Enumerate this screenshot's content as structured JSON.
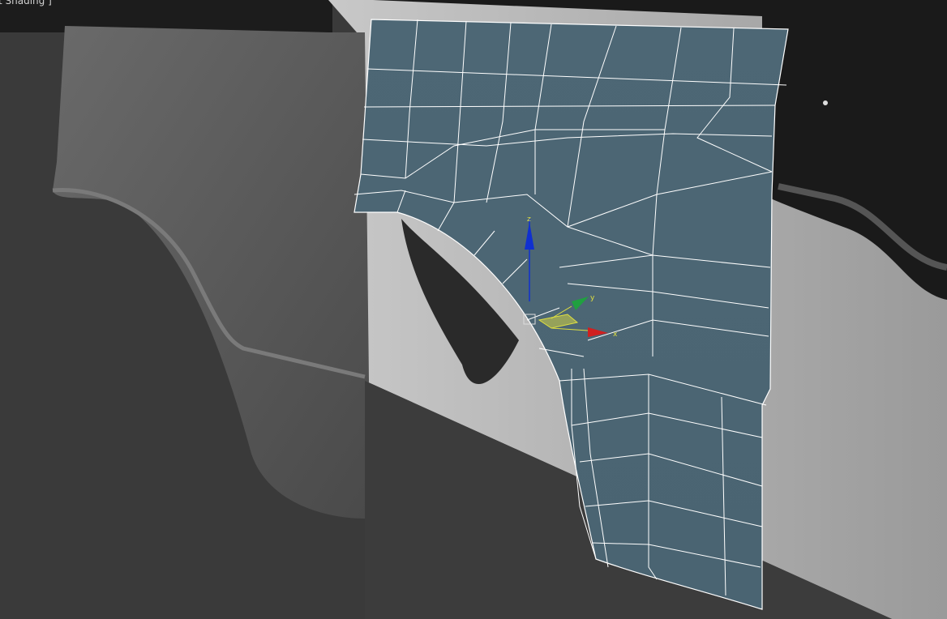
{
  "viewport": {
    "shading_label": "t Shading ]",
    "gizmo": {
      "x_label": "x",
      "y_label": "y",
      "z_label": "z"
    },
    "colors": {
      "mesh": "#4e6a79",
      "wire": "#ffffff",
      "x_axis": "#d02020",
      "y_axis": "#20a040",
      "z_axis": "#1030d0",
      "plane": "#e0e040"
    }
  }
}
